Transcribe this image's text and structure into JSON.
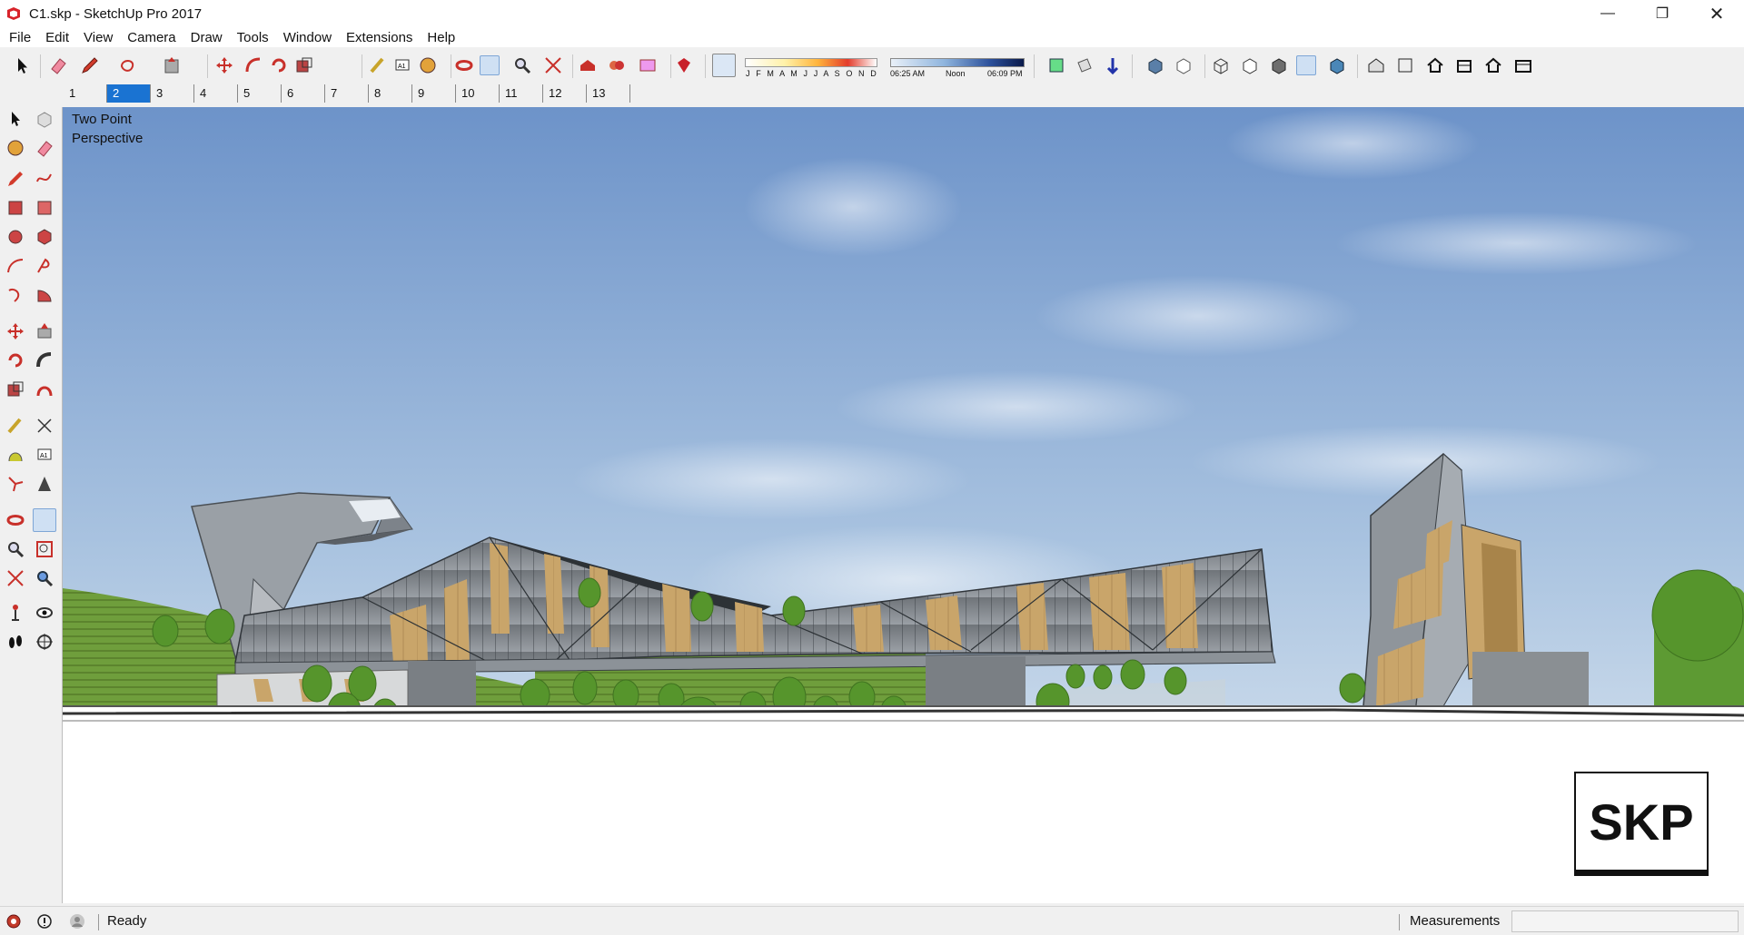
{
  "window": {
    "title": "C1.skp - SketchUp Pro 2017",
    "minimize": "—",
    "maximize": "❐",
    "close": "✕"
  },
  "menu": [
    "File",
    "Edit",
    "View",
    "Camera",
    "Draw",
    "Tools",
    "Window",
    "Extensions",
    "Help"
  ],
  "shadows": {
    "months": "J F M A M J J A S O N D",
    "time_start": "06:25 AM",
    "time_mid": "Noon",
    "time_end": "06:09 PM"
  },
  "scenes": {
    "tabs": [
      "1",
      "2",
      "3",
      "4",
      "5",
      "6",
      "7",
      "8",
      "9",
      "10",
      "11",
      "12",
      "13"
    ],
    "active_index": 1
  },
  "viewport": {
    "camera_label_line1": "Two Point",
    "camera_label_line2": "Perspective"
  },
  "logo": {
    "text": "SKP"
  },
  "status": {
    "text": "Ready",
    "measurements_label": "Measurements",
    "measurements_value": ""
  },
  "colors": {
    "accent": "#1a73d2",
    "sky_top": "#6f94c9",
    "sky_bottom": "#dde8f2",
    "grass": "#6fa23f",
    "glass": "#8a8f96",
    "wood": "#c9a56a"
  },
  "icons": {
    "toolbar": [
      "select-icon",
      "eraser-icon",
      "pencil-icon",
      "shape-icon",
      "push-pull-icon",
      "move-icon",
      "follow-me-icon",
      "rotate-icon",
      "scale-icon",
      "tape-measure-icon",
      "text-icon",
      "paint-bucket-icon",
      "orbit-icon",
      "pan-icon",
      "zoom-icon",
      "zoom-extents-icon",
      "warehouse-icon",
      "extension-warehouse-icon",
      "layout-icon",
      "ruby-icon",
      "shadow-toggle-icon",
      "section-plane-icon",
      "display-section-icon",
      "section-cut-icon",
      "xray-icon",
      "back-edges-icon",
      "wireframe-icon",
      "hidden-line-icon",
      "shaded-icon",
      "shaded-textures-icon",
      "monochrome-icon",
      "iso-view-icon",
      "top-view-icon",
      "front-view-icon",
      "right-view-icon",
      "back-view-icon",
      "left-view-icon"
    ]
  }
}
